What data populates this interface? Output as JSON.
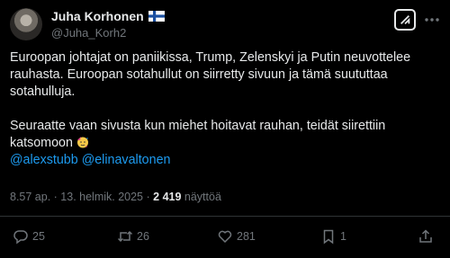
{
  "tweet": {
    "display_name": "Juha Korhonen",
    "handle": "@Juha_Korh2",
    "text_p1": "Euroopan johtajat on paniikissa, Trump, Zelenskyi ja Putin neuvottelee rauhasta. Euroopan sotahullut on siirretty sivuun ja tämä suututtaa sotahulluja.",
    "text_p2": "Seuraatte vaan sivusta kun miehet hoitavat rauhan, teidät siirettiin katsomoon",
    "mentions": [
      "@alexstubb",
      "@elinavaltonen"
    ],
    "timestamp": "8.57 ap. · 13. helmik. 2025 ·",
    "views_count": "2 419",
    "views_label": "näyttöä"
  },
  "actions": {
    "reply_count": "25",
    "retweet_count": "26",
    "like_count": "281",
    "bookmark_count": "1"
  },
  "icons": {
    "flag": "finland-flag-icon",
    "grok": "grok-icon",
    "emoji": "partying-face-emoji"
  },
  "colors": {
    "background": "#000000",
    "text": "#e7e9ea",
    "muted": "#71767b",
    "link": "#1d9bf0"
  }
}
